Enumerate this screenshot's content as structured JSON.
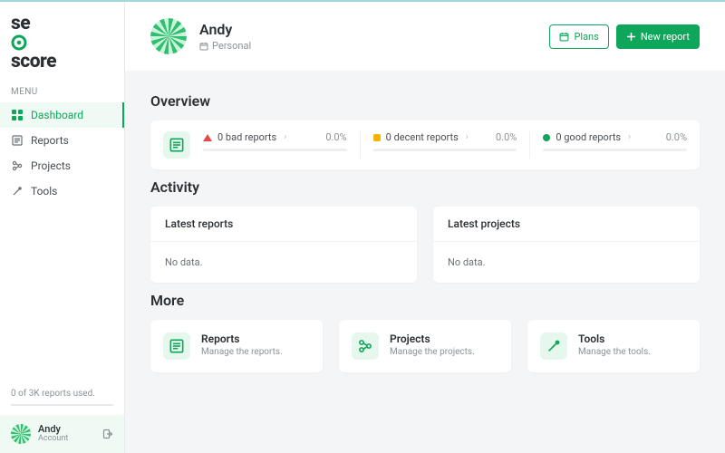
{
  "brand": {
    "text1": "se",
    "text2": "score"
  },
  "sidebar": {
    "menu_label": "MENU",
    "items": [
      {
        "label": "Dashboard"
      },
      {
        "label": "Reports"
      },
      {
        "label": "Projects"
      },
      {
        "label": "Tools"
      }
    ],
    "usage_text": "0 of 3K reports used.",
    "account": {
      "name": "Andy",
      "role": "Account"
    }
  },
  "header": {
    "name": "Andy",
    "subtitle": "Personal",
    "plans_label": "Plans",
    "new_report_label": "New report"
  },
  "overview": {
    "title": "Overview",
    "cells": [
      {
        "label": "0 bad reports",
        "pct": "0.0%"
      },
      {
        "label": "0 decent reports",
        "pct": "0.0%"
      },
      {
        "label": "0 good reports",
        "pct": "0.0%"
      }
    ]
  },
  "activity": {
    "title": "Activity",
    "cards": [
      {
        "title": "Latest reports",
        "body": "No data."
      },
      {
        "title": "Latest projects",
        "body": "No data."
      }
    ]
  },
  "more": {
    "title": "More",
    "cards": [
      {
        "title": "Reports",
        "sub": "Manage the reports."
      },
      {
        "title": "Projects",
        "sub": "Manage the projects."
      },
      {
        "title": "Tools",
        "sub": "Manage the tools."
      }
    ]
  }
}
